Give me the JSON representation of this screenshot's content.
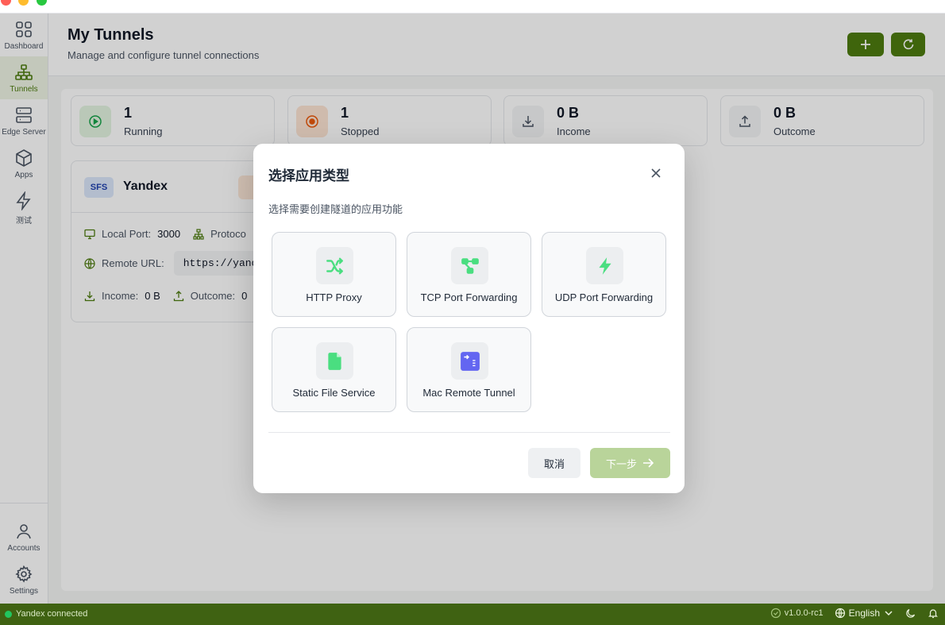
{
  "sidebar": {
    "items": [
      {
        "label": "Dashboard",
        "icon": "grid-icon"
      },
      {
        "label": "Tunnels",
        "icon": "network-icon",
        "active": true
      },
      {
        "label": "Edge Server",
        "icon": "server-icon"
      },
      {
        "label": "Apps",
        "icon": "box-icon"
      },
      {
        "label": "测试",
        "icon": "zap-icon"
      }
    ],
    "bottom": [
      {
        "label": "Accounts",
        "icon": "user-icon"
      },
      {
        "label": "Settings",
        "icon": "gear-icon"
      }
    ]
  },
  "header": {
    "title": "My Tunnels",
    "subtitle": "Manage and configure tunnel connections"
  },
  "stats": [
    {
      "value": "1",
      "label": "Running",
      "icon": "play-circle-icon"
    },
    {
      "value": "1",
      "label": "Stopped",
      "icon": "stop-circle-icon"
    },
    {
      "value": "0 B",
      "label": "Income",
      "icon": "download-icon"
    },
    {
      "value": "0 B",
      "label": "Outcome",
      "icon": "upload-icon"
    }
  ],
  "tunnel": {
    "badge": "SFS",
    "name": "Yandex",
    "local_port_label": "Local Port:",
    "local_port": "3000",
    "protocol_label": "Protoco",
    "remote_url_label": "Remote URL:",
    "remote_url": "https://yand",
    "income_label": "Income:",
    "income": "0 B",
    "outcome_label": "Outcome:",
    "outcome": "0"
  },
  "dialog": {
    "title": "选择应用类型",
    "subtitle": "选择需要创建隧道的应用功能",
    "options": [
      {
        "label": "HTTP Proxy",
        "icon": "shuffle-icon"
      },
      {
        "label": "TCP Port Forwarding",
        "icon": "network-nodes-icon"
      },
      {
        "label": "UDP Port Forwarding",
        "icon": "bolt-icon"
      },
      {
        "label": "Static File Service",
        "icon": "file-icon"
      },
      {
        "label": "Mac Remote Tunnel",
        "icon": "remote-terminal-icon"
      }
    ],
    "cancel_label": "取消",
    "next_label": "下一步"
  },
  "statusbar": {
    "connection": "Yandex connected",
    "version": "v1.0.0-rc1",
    "language": "English"
  },
  "colors": {
    "accent": "#4d7c0f",
    "statusbar": "#3f6212",
    "next_disabled": "#b9d49a",
    "option_green": "#4ade80",
    "option_purple": "#6366f1"
  }
}
